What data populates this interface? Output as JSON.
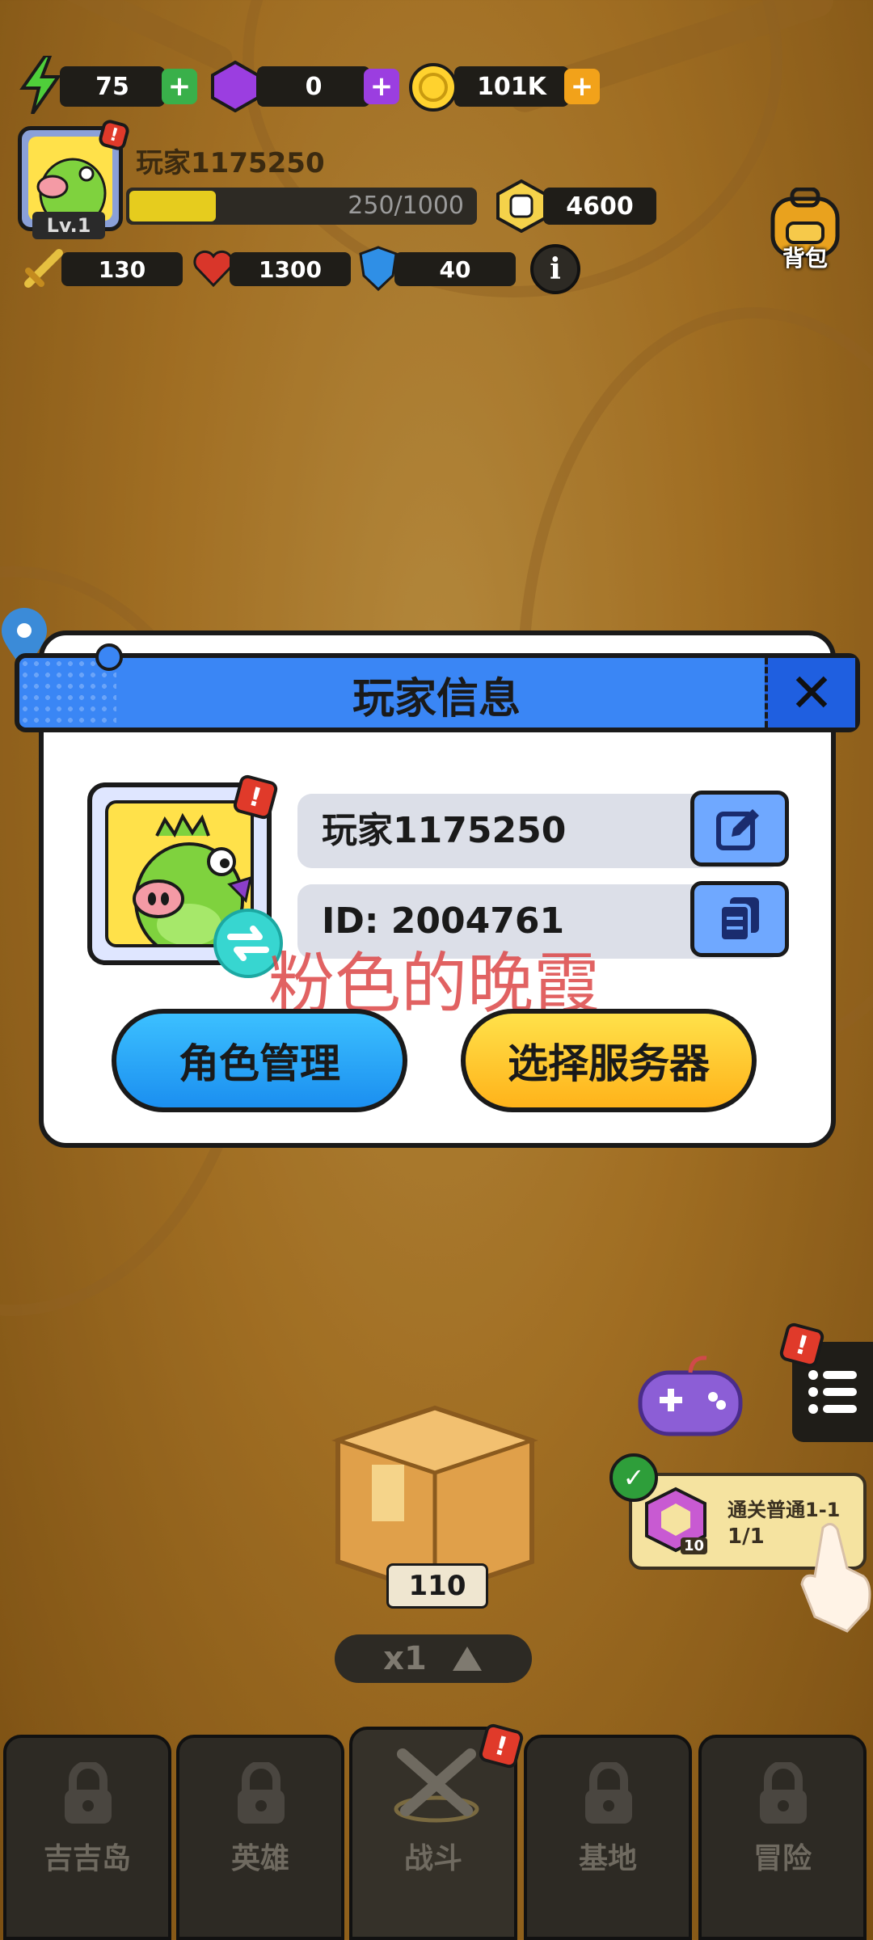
{
  "hud": {
    "energy": "75",
    "gems": "0",
    "coins": "101K",
    "player_name": "玩家1175250",
    "level": "Lv.1",
    "xp_text": "250/1000",
    "xp_progress": 0.25,
    "power": "4600",
    "attack": "130",
    "health": "1300",
    "defense": "40",
    "backpack_label": "背包"
  },
  "dialog": {
    "title": "玩家信息",
    "name_value": "玩家1175250",
    "id_value": "ID: 2004761",
    "role_button": "角色管理",
    "server_button": "选择服务器"
  },
  "watermark": "粉色的晚霞",
  "quest": {
    "title": "通关普通1-1",
    "progress": "1/1",
    "badge": "10"
  },
  "chest": {
    "count": "110",
    "multiplier": "x1"
  },
  "nav": {
    "tabs": [
      "吉吉岛",
      "英雄",
      "战斗",
      "基地",
      "冒险"
    ]
  },
  "colors": {
    "accent_blue": "#3a86f5",
    "accent_yellow": "#ffcc1a",
    "alert_red": "#e03a2a"
  }
}
